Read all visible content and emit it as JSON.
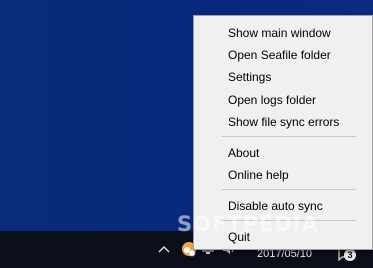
{
  "menu": {
    "items": [
      {
        "label": "Show main window"
      },
      {
        "label": "Open Seafile folder"
      },
      {
        "label": "Settings"
      },
      {
        "label": "Open logs folder"
      },
      {
        "label": "Show file sync errors"
      },
      {
        "label": "About"
      },
      {
        "label": "Online help"
      },
      {
        "label": "Disable auto sync"
      },
      {
        "label": "Quit"
      }
    ]
  },
  "taskbar": {
    "date": "2017/05/10",
    "notification_count": "3"
  },
  "watermark": {
    "text": "SOFTPEDIA"
  },
  "icons": {
    "tray_overflow": "chevron-up-icon",
    "seafile": "seafile-tray-icon",
    "network": "network-icon",
    "volume": "volume-icon",
    "notifications": "notification-icon"
  }
}
